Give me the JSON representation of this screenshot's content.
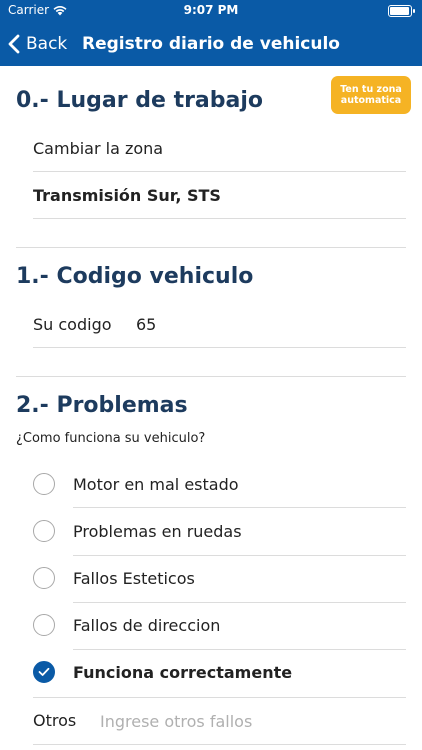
{
  "status_bar": {
    "carrier": "Carrier",
    "time": "9:07 PM"
  },
  "nav": {
    "back_label": "Back",
    "title": "Registro diario de vehiculo"
  },
  "zone_button": {
    "line1": "Ten tu zona",
    "line2": "automatica"
  },
  "section0": {
    "title": "0.- Lugar de trabajo",
    "change_zone": "Cambiar la zona",
    "zone_value": "Transmisión Sur, STS"
  },
  "section1": {
    "title": "1.- Codigo vehiculo",
    "code_label": "Su codigo",
    "code_value": "65"
  },
  "section2": {
    "title": "2.- Problemas",
    "question": "¿Como funciona su vehiculo?",
    "options": [
      {
        "label": "Motor en mal estado",
        "checked": false
      },
      {
        "label": "Problemas en ruedas",
        "checked": false
      },
      {
        "label": "Fallos Esteticos",
        "checked": false
      },
      {
        "label": "Fallos de direccion",
        "checked": false
      },
      {
        "label": "Funciona correctamente",
        "checked": true
      }
    ],
    "otros_label": "Otros",
    "otros_placeholder": "Ingrese otros fallos"
  },
  "colors": {
    "primary": "#0a5aa6",
    "accent": "#f5b324",
    "heading": "#1d3b5e"
  }
}
